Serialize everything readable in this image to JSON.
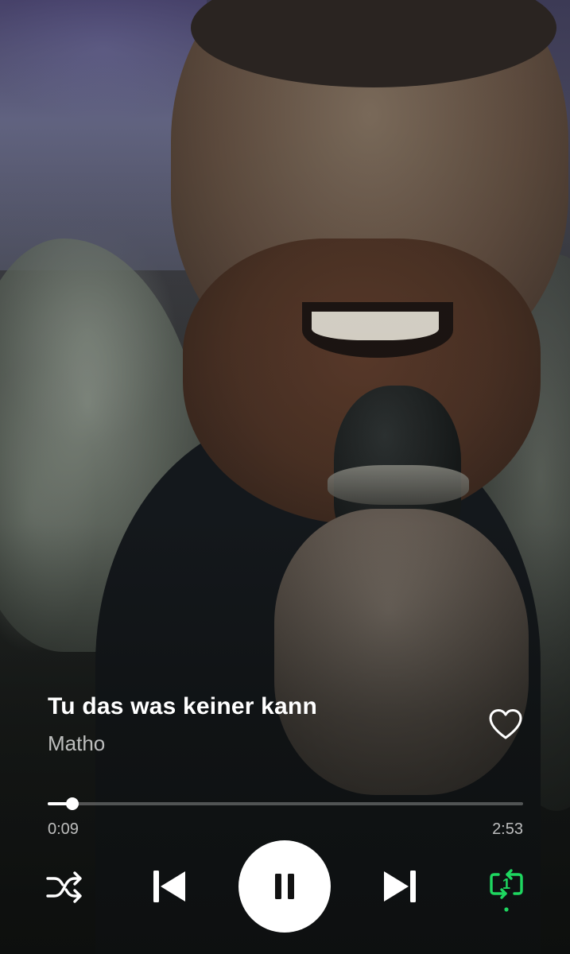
{
  "track": {
    "title": "Tu das was keiner kann",
    "artist": "Matho",
    "liked": false
  },
  "playback": {
    "elapsed": "0:09",
    "duration": "2:53",
    "progress_fraction": 0.052,
    "state": "playing"
  },
  "controls": {
    "shuffle_icon": "shuffle-icon",
    "previous_icon": "skip-previous-icon",
    "play_pause_icon": "pause-icon",
    "next_icon": "skip-next-icon",
    "repeat_icon": "repeat-one-icon",
    "repeat_mode": "one",
    "repeat_badge": "1"
  },
  "colors": {
    "accent": "#1ed760",
    "text_primary": "#ffffff",
    "text_secondary": "#b8b8b8"
  }
}
